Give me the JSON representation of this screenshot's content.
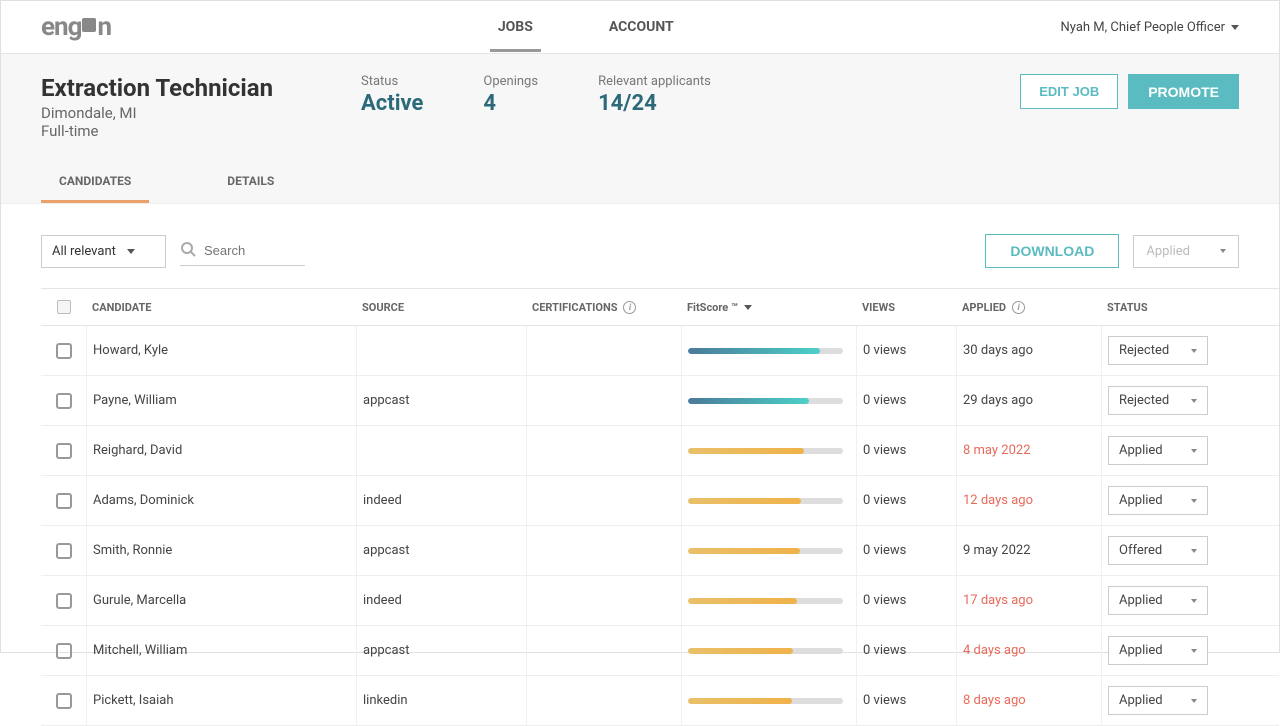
{
  "header": {
    "logo_text_before": "eng",
    "logo_text_after": "n",
    "nav": [
      {
        "label": "JOBS",
        "active": true
      },
      {
        "label": "ACCOUNT",
        "active": false
      }
    ],
    "user": "Nyah M, Chief People Officer"
  },
  "job": {
    "title": "Extraction Technician",
    "location": "Dimondale, MI",
    "type": "Full-time",
    "status_label": "Status",
    "status_value": "Active",
    "openings_label": "Openings",
    "openings_value": "4",
    "relevant_label": "Relevant applicants",
    "relevant_value": "14/24",
    "edit_btn": "EDIT JOB",
    "promote_btn": "PROMOTE"
  },
  "subtabs": [
    {
      "label": "CANDIDATES",
      "active": true
    },
    {
      "label": "DETAILS",
      "active": false
    }
  ],
  "toolbar": {
    "filter": "All relevant",
    "search_placeholder": "Search",
    "download": "DOWNLOAD",
    "bulk_action": "Applied"
  },
  "columns": {
    "candidate": "CANDIDATE",
    "source": "SOURCE",
    "certifications": "CERTIFICATIONS",
    "fitscore": "FitScore ™",
    "views": "VIEWS",
    "applied": "APPLIED",
    "status": "STATUS"
  },
  "rows": [
    {
      "candidate": "Howard, Kyle",
      "source": "",
      "cert": "",
      "fit": 85,
      "fit_color": "teal",
      "views": "0 views",
      "applied": "30 days ago",
      "applied_red": false,
      "status": "Rejected"
    },
    {
      "candidate": "Payne, William",
      "source": "appcast",
      "cert": "",
      "fit": 78,
      "fit_color": "teal",
      "views": "0 views",
      "applied": "29 days ago",
      "applied_red": false,
      "status": "Rejected"
    },
    {
      "candidate": "Reighard, David",
      "source": "",
      "cert": "",
      "fit": 75,
      "fit_color": "orange",
      "views": "0 views",
      "applied": "8 may 2022",
      "applied_red": true,
      "status": "Applied"
    },
    {
      "candidate": "Adams, Dominick",
      "source": "indeed",
      "cert": "",
      "fit": 73,
      "fit_color": "orange",
      "views": "0 views",
      "applied": "12 days ago",
      "applied_red": true,
      "status": "Applied"
    },
    {
      "candidate": "Smith, Ronnie",
      "source": "appcast",
      "cert": "",
      "fit": 72,
      "fit_color": "orange",
      "views": "0 views",
      "applied": "9 may 2022",
      "applied_red": false,
      "status": "Offered"
    },
    {
      "candidate": "Gurule, Marcella",
      "source": "indeed",
      "cert": "",
      "fit": 70,
      "fit_color": "orange",
      "views": "0 views",
      "applied": "17 days ago",
      "applied_red": true,
      "status": "Applied"
    },
    {
      "candidate": "Mitchell, William",
      "source": "appcast",
      "cert": "",
      "fit": 68,
      "fit_color": "orange",
      "views": "0 views",
      "applied": "4 days ago",
      "applied_red": true,
      "status": "Applied"
    },
    {
      "candidate": "Pickett, Isaiah",
      "source": "linkedin",
      "cert": "",
      "fit": 67,
      "fit_color": "orange",
      "views": "0 views",
      "applied": "8 days ago",
      "applied_red": true,
      "status": "Applied"
    }
  ]
}
